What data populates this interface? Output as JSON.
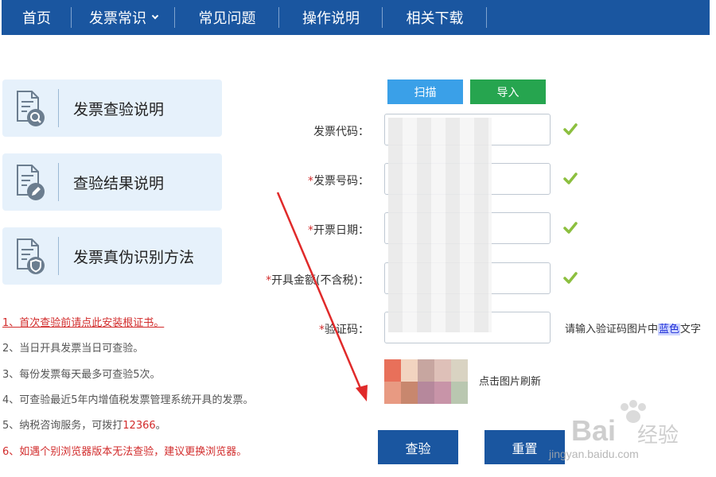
{
  "nav": {
    "items": [
      {
        "label": "首页"
      },
      {
        "label": "发票常识"
      },
      {
        "label": "常见问题"
      },
      {
        "label": "操作说明"
      },
      {
        "label": "相关下载"
      }
    ]
  },
  "cards": [
    {
      "label": "发票查验说明",
      "icon": "document-search-icon"
    },
    {
      "label": "查验结果说明",
      "icon": "document-edit-icon"
    },
    {
      "label": "发票真伪识别方法",
      "icon": "document-shield-icon"
    }
  ],
  "notes": [
    "1、首次查验前请点此安装根证书。",
    "2、当日开具发票当日可查验。",
    "3、每份发票每天最多可查验5次。",
    "4、可查验最近5年内增值税发票管理系统开具的发票。",
    {
      "prefix": "5、纳税咨询服务，可拨打",
      "number": "12366",
      "suffix": "。"
    },
    "6、如遇个别浏览器版本无法查验，建议更换浏览器。"
  ],
  "form": {
    "scan_label": "扫描",
    "import_label": "导入",
    "fields": [
      {
        "label": "发票代码：",
        "required": false
      },
      {
        "label": "发票号码：",
        "required": true
      },
      {
        "label": "开票日期：",
        "required": true
      },
      {
        "label": "开具金额(不含税)：",
        "required": true
      },
      {
        "label": "验证码：",
        "required": true
      }
    ],
    "captcha_hint": {
      "prefix": "请输入验证码图片中",
      "highlight": "蓝色",
      "suffix": "文字"
    },
    "refresh_label": "点击图片刷新",
    "query_label": "查验",
    "reset_label": "重置"
  },
  "colors": {
    "nav_bg": "#1a56a0",
    "scan_btn": "#3aa0e8",
    "import_btn": "#26a54f",
    "check": "#8cbf3f",
    "required": "#d22c2c"
  },
  "watermark": {
    "brand": "Bai",
    "brand2": "经验",
    "url": "jingyan.baidu.com"
  }
}
